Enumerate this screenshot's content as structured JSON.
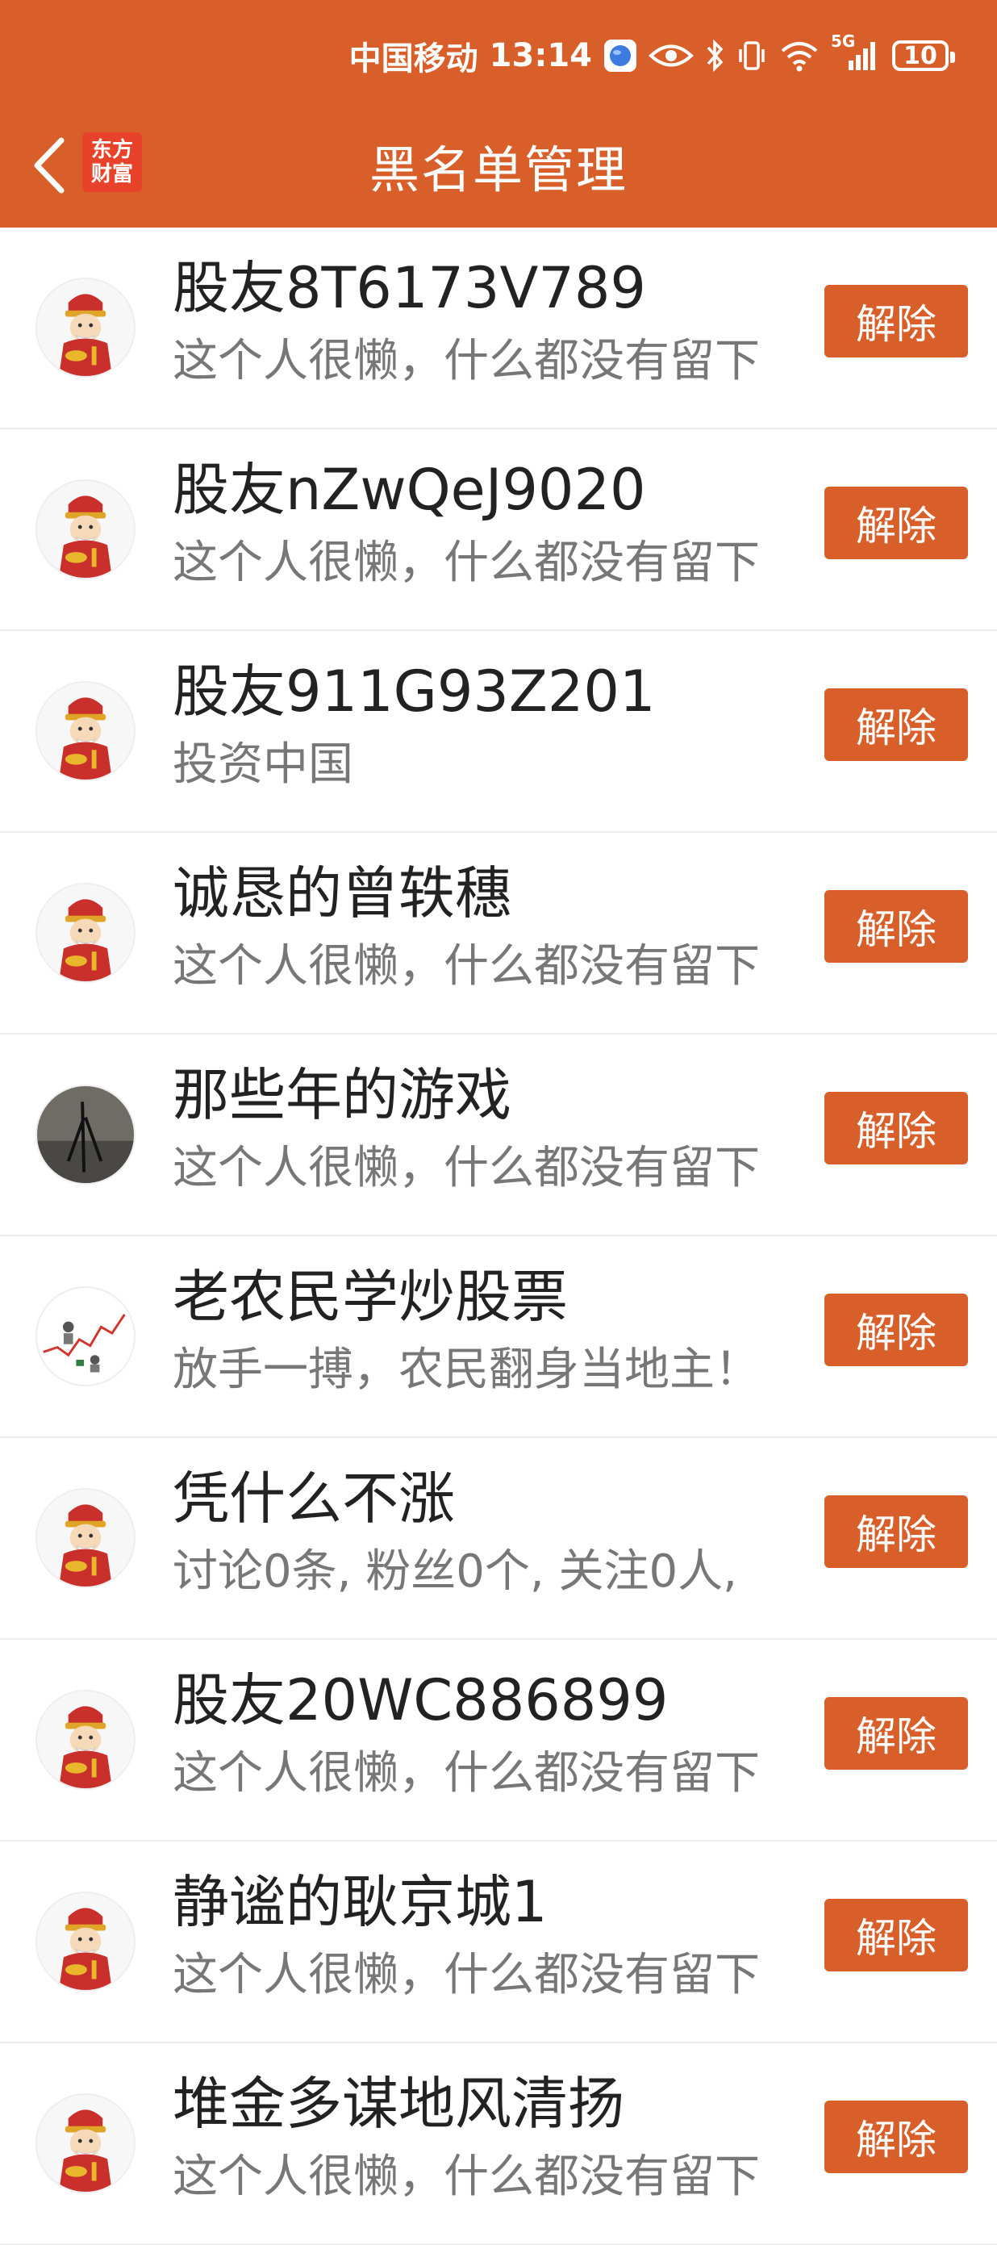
{
  "status": {
    "carrier": "中国移动",
    "time": "13:14",
    "network": "5G",
    "battery": "10"
  },
  "nav": {
    "title": "黑名单管理",
    "logo_line1": "东方",
    "logo_line2": "财富"
  },
  "list": {
    "button_label": "解除",
    "items": [
      {
        "name": "股友8T6173V789",
        "bio": "这个人很懒，什么都没有留下",
        "avatar": "fortune-god"
      },
      {
        "name": "股友nZwQeJ9020",
        "bio": "这个人很懒，什么都没有留下",
        "avatar": "fortune-god"
      },
      {
        "name": "股友911G93Z201",
        "bio": "投资中国",
        "avatar": "fortune-god"
      },
      {
        "name": "诚恳的曾轶穗",
        "bio": "这个人很懒，什么都没有留下",
        "avatar": "fortune-god"
      },
      {
        "name": "那些年的游戏",
        "bio": "这个人很懒，什么都没有留下",
        "avatar": "photo"
      },
      {
        "name": "老农民学炒股票",
        "bio": "放手一搏，农民翻身当地主！",
        "avatar": "chart"
      },
      {
        "name": "凭什么不涨",
        "bio": "讨论0条, 粉丝0个, 关注0人,",
        "avatar": "fortune-god"
      },
      {
        "name": "股友20WC886899",
        "bio": "这个人很懒，什么都没有留下",
        "avatar": "fortune-god"
      },
      {
        "name": "静谧的耿京城1",
        "bio": "这个人很懒，什么都没有留下",
        "avatar": "fortune-god"
      },
      {
        "name": "堆金多谋地风清扬",
        "bio": "这个人很懒，什么都没有留下",
        "avatar": "fortune-god"
      }
    ]
  }
}
